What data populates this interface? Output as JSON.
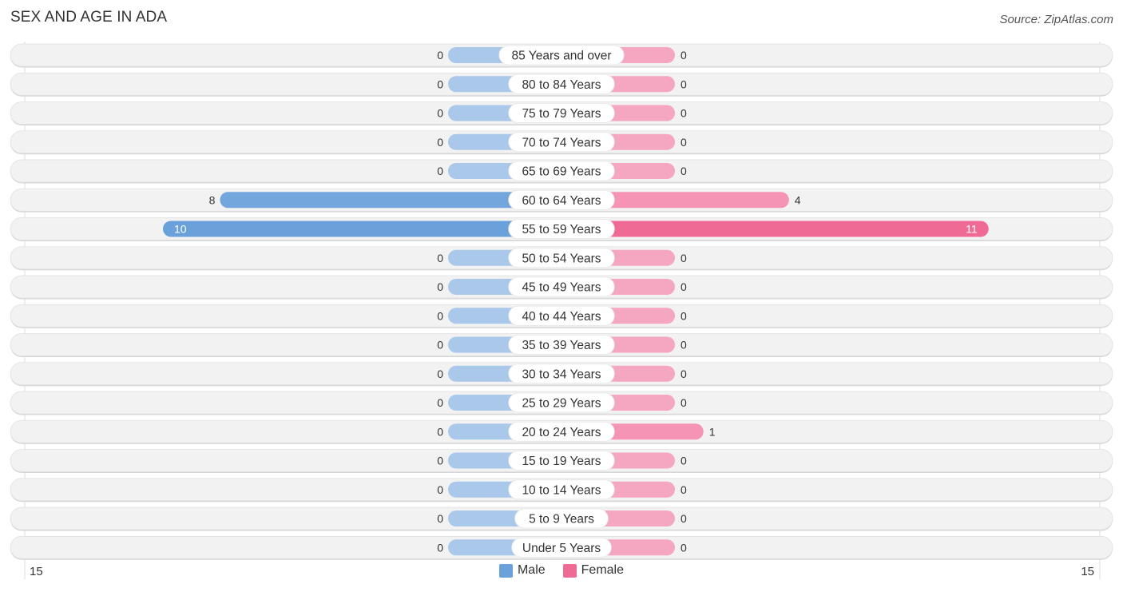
{
  "header": {
    "title": "SEX AND AGE IN ADA",
    "source": "Source: ZipAtlas.com"
  },
  "colors": {
    "male_strong": "#6aa1db",
    "male_light": "#a9c8ea",
    "female_strong": "#f06a96",
    "female_light": "#f5a6c0",
    "row_bg": "#f2f2f2"
  },
  "chart_data": {
    "type": "bar",
    "orientation": "horizontal-diverging",
    "title": "SEX AND AGE IN ADA",
    "categories": [
      "85 Years and over",
      "80 to 84 Years",
      "75 to 79 Years",
      "70 to 74 Years",
      "65 to 69 Years",
      "60 to 64 Years",
      "55 to 59 Years",
      "50 to 54 Years",
      "45 to 49 Years",
      "40 to 44 Years",
      "35 to 39 Years",
      "30 to 34 Years",
      "25 to 29 Years",
      "20 to 24 Years",
      "15 to 19 Years",
      "10 to 14 Years",
      "5 to 9 Years",
      "Under 5 Years"
    ],
    "series": [
      {
        "name": "Male",
        "values": [
          0,
          0,
          0,
          0,
          0,
          8,
          10,
          0,
          0,
          0,
          0,
          0,
          0,
          0,
          0,
          0,
          0,
          0
        ]
      },
      {
        "name": "Female",
        "values": [
          0,
          0,
          0,
          0,
          0,
          4,
          11,
          0,
          0,
          0,
          0,
          0,
          0,
          1,
          0,
          0,
          0,
          0
        ]
      }
    ],
    "axis": {
      "left_tick": "15",
      "right_tick": "15",
      "range": [
        -15,
        15
      ]
    },
    "legend": {
      "position": "bottom-center",
      "entries": [
        "Male",
        "Female"
      ]
    },
    "grid": false
  }
}
